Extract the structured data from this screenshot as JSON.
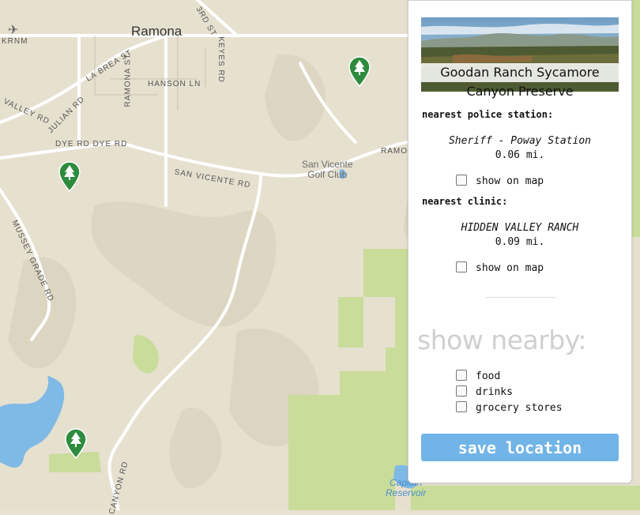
{
  "map": {
    "airport_label": "KRNM",
    "city_label": "Ramona",
    "roads": {
      "la_brea": "LA BREA ST",
      "ramona_st": "RAMONA ST",
      "hanson": "HANSON LN",
      "third": "3RD ST",
      "keyes": "KEYES RD",
      "valley": "VALLEY RD",
      "julian": "JULIAN RD",
      "dye": "DYE RD  DYE RD",
      "san_vicente": "SAN VICENTE RD",
      "ramona_east": "RAMON",
      "mussey": "MUSSEY GRADE RD",
      "canyon": "CANYON RD"
    },
    "golf_club": "San Vicente\nGolf Club",
    "reservoir": "Capitan\nReservoir"
  },
  "panel": {
    "place_title_line1": "Goodan Ranch Sycamore",
    "place_title_line2": "Canyon Preserve",
    "police": {
      "heading": "nearest police station:",
      "name": "Sheriff - Poway Station",
      "distance": "0.06 mi.",
      "show_label": "show on map"
    },
    "clinic": {
      "heading": "nearest clinic:",
      "name": "HIDDEN VALLEY RANCH",
      "distance": "0.09 mi.",
      "show_label": "show on map"
    },
    "nearby": {
      "title": "show nearby:",
      "options": [
        "food",
        "drinks",
        "grocery stores"
      ]
    },
    "save_label": "save location"
  },
  "colors": {
    "map_base": "#e8e2d2",
    "park_green": "#c9dc9a",
    "pin_green": "#2e8b3e",
    "button_blue": "#71b4e7"
  }
}
